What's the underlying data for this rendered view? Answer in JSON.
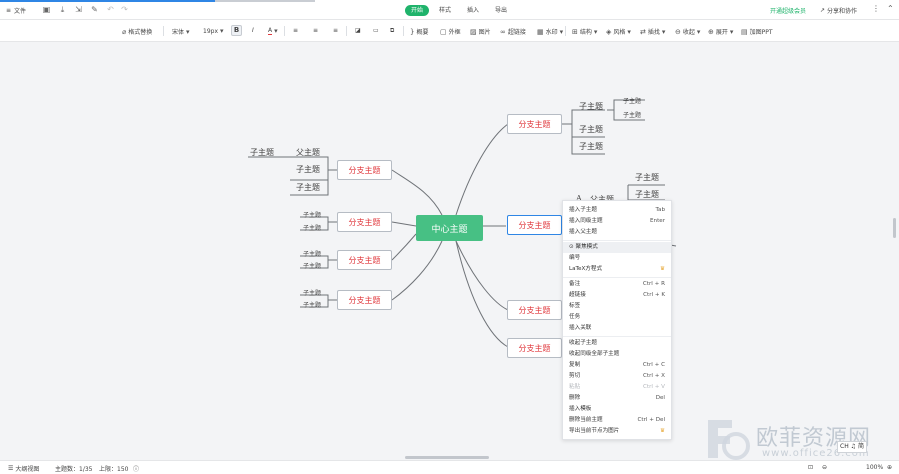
{
  "topbar": {
    "file_label": "文件",
    "tabs": [
      {
        "label": "开始",
        "active": true
      },
      {
        "label": "样式",
        "active": false
      },
      {
        "label": "插入",
        "active": false
      },
      {
        "label": "导出",
        "active": false
      }
    ],
    "vip_label": "开通超级会员",
    "share_label": "分享和协作",
    "accent": "#1fb36b"
  },
  "format_toolbar": {
    "format_painter": "格式替换",
    "font_family": "宋体",
    "font_size": "19px",
    "bold": "B",
    "italic": "I",
    "font_color": "A",
    "summary": "概要",
    "outer_frame": "外框",
    "image": "图片",
    "hyperlink": "超链接",
    "watermark": "水印",
    "structure": "结构",
    "style": "风格",
    "relation": "插找",
    "collapse": "收起",
    "expand": "展开",
    "ppt": "加图PPT"
  },
  "mindmap": {
    "center": "中心主题",
    "branch": "分支主题",
    "topic": "子主题",
    "parent": "父主题",
    "a_label": "A"
  },
  "context_menu": {
    "items": [
      {
        "label": "插入子主题",
        "shortcut": "Tab"
      },
      {
        "label": "插入同级主题",
        "shortcut": "Enter"
      },
      {
        "label": "插入父主题",
        "shortcut": ""
      },
      {
        "label": "聚焦模式",
        "shortcut": ""
      },
      {
        "label": "编号",
        "shortcut": ""
      },
      {
        "label": "LaTeX方程式",
        "shortcut": ""
      },
      {
        "label": "备注",
        "shortcut": "Ctrl + R"
      },
      {
        "label": "超链接",
        "shortcut": "Ctrl + K"
      },
      {
        "label": "标签",
        "shortcut": ""
      },
      {
        "label": "任务",
        "shortcut": ""
      },
      {
        "label": "插入关联",
        "shortcut": ""
      },
      {
        "label": "收起子主题",
        "shortcut": ""
      },
      {
        "label": "收起同级全部子主题",
        "shortcut": ""
      },
      {
        "label": "复制",
        "shortcut": "Ctrl + C"
      },
      {
        "label": "剪切",
        "shortcut": "Ctrl + X"
      },
      {
        "label": "粘贴",
        "shortcut": "Ctrl + V"
      },
      {
        "label": "删除",
        "shortcut": "Del"
      },
      {
        "label": "插入模板",
        "shortcut": ""
      },
      {
        "label": "删除当前主题",
        "shortcut": "Ctrl + Del"
      },
      {
        "label": "导出当前节点为图片",
        "shortcut": ""
      }
    ]
  },
  "statusbar": {
    "outline_view": "大纲视图",
    "topic_count": "主题数：1/35",
    "limit": "上限：150",
    "zoom": "100%"
  },
  "ime": "CH ♫ 简",
  "watermark": {
    "title": "欧菲资源网",
    "url": "www.office26.com"
  }
}
